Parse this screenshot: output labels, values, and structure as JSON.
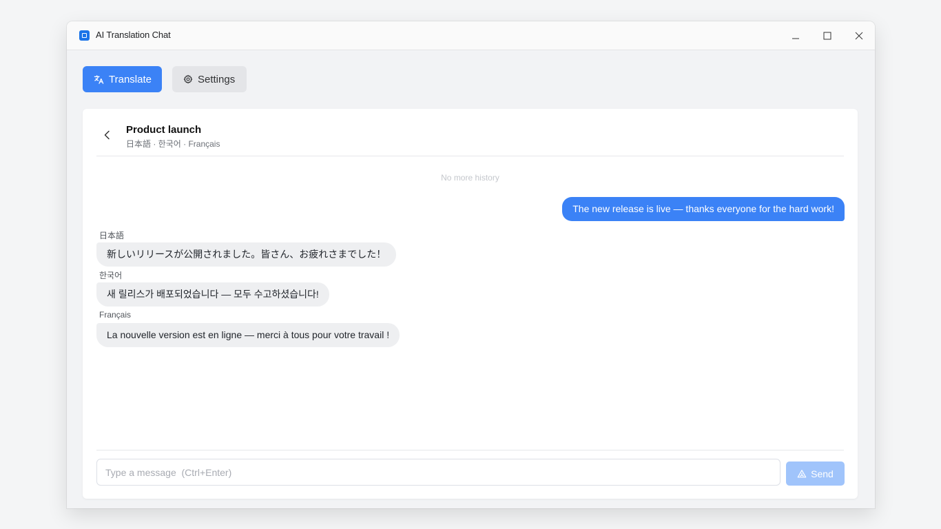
{
  "window": {
    "title": "AI Translation Chat",
    "app_icon": "app-logo-icon",
    "controls": [
      "minimize-icon",
      "maximize-icon",
      "close-icon"
    ]
  },
  "toolbar": {
    "translate_label": "Translate",
    "translate_icon": "translate-icon",
    "settings_label": "Settings",
    "settings_icon": "gear-icon"
  },
  "conversation": {
    "title": "Product launch",
    "languages": "日本語 · 한국어 · Français",
    "back_icon": "chevron-left-icon",
    "no_more_history": "No more history",
    "user_message": "The new release is live — thanks everyone for the hard work!",
    "translations": [
      {
        "lang": "日本語",
        "text": "新しいリリースが公開されました。皆さん、お疲れさまでした！"
      },
      {
        "lang": "한국어",
        "text": "새 릴리스가 배포되었습니다 — 모두 수고하셨습니다!"
      },
      {
        "lang": "Français",
        "text": "La nouvelle version est en ligne — merci à tous pour votre travail !"
      }
    ]
  },
  "composer": {
    "placeholder": "Type a message  (Ctrl+Enter)",
    "value": "",
    "send_label": "Send",
    "send_icon": "send-icon",
    "send_disabled": true
  },
  "colors": {
    "accent": "#3b82f6",
    "accent_disabled": "#a0c4fb",
    "bot_bubble": "#eeeff1",
    "app_icon": "#1a73e8"
  }
}
